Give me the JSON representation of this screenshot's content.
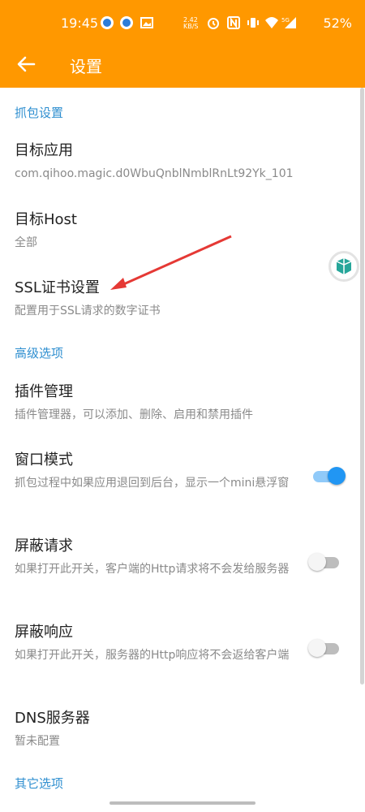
{
  "status_bar": {
    "time": "19:45",
    "net_speed_top": "2.42",
    "net_speed_bottom": "KB/S",
    "network": "5G",
    "battery": "52%"
  },
  "toolbar": {
    "title": "设置"
  },
  "sections": {
    "capture": {
      "header": "抓包设置",
      "target_app": {
        "title": "目标应用",
        "summary": "com.qihoo.magic.d0WbuQnblNmblRnLt92Yk_101"
      },
      "target_host": {
        "title": "目标Host",
        "summary": "全部"
      },
      "ssl_cert": {
        "title": "SSL证书设置",
        "summary": "配置用于SSL请求的数字证书"
      }
    },
    "advanced": {
      "header": "高级选项",
      "plugin": {
        "title": "插件管理",
        "summary": "插件管理器，可以添加、删除、启用和禁用插件"
      },
      "window_mode": {
        "title": "窗口模式",
        "summary": "抓包过程中如果应用退回到后台，显示一个mini悬浮窗",
        "enabled": true
      },
      "block_request": {
        "title": "屏蔽请求",
        "summary": "如果打开此开关，客户端的Http请求将不会发给服务器",
        "enabled": false
      },
      "block_response": {
        "title": "屏蔽响应",
        "summary": "如果打开此开关，服务器的Http响应将不会返给客户端",
        "enabled": false
      },
      "dns": {
        "title": "DNS服务器",
        "summary": "暂未配置"
      }
    },
    "other": {
      "header": "其它选项"
    }
  },
  "colors": {
    "appbar": "#FF9800",
    "section_header": "#2f8fd0",
    "switch_on_thumb": "#2196F3",
    "switch_on_track": "#90CAF9",
    "annotation_arrow": "#e53935"
  }
}
